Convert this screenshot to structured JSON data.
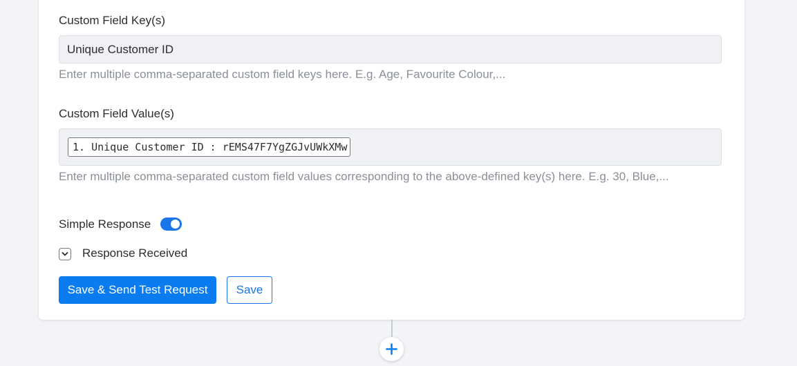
{
  "form": {
    "keys_label": "Custom Field Key(s)",
    "keys_value": "Unique Customer ID",
    "keys_hint": "Enter multiple comma-separated custom field keys here. E.g. Age, Favourite Colour,...",
    "values_label": "Custom Field Value(s)",
    "values_tag": "1. Unique Customer ID : rEMS47F7YgZGJvUWkXMw",
    "values_hint": "Enter multiple comma-separated custom field values corresponding to the above-defined key(s) here. E.g. 30, Blue,...",
    "simple_response_label": "Simple Response",
    "simple_response_on": true,
    "response_received_label": "Response Received"
  },
  "actions": {
    "save_send_label": "Save & Send Test Request",
    "save_label": "Save"
  },
  "icons": {
    "chevron": "chevron-down-icon",
    "add": "plus-icon"
  },
  "colors": {
    "accent": "#0a7cf0",
    "background": "#f2f4f8"
  }
}
